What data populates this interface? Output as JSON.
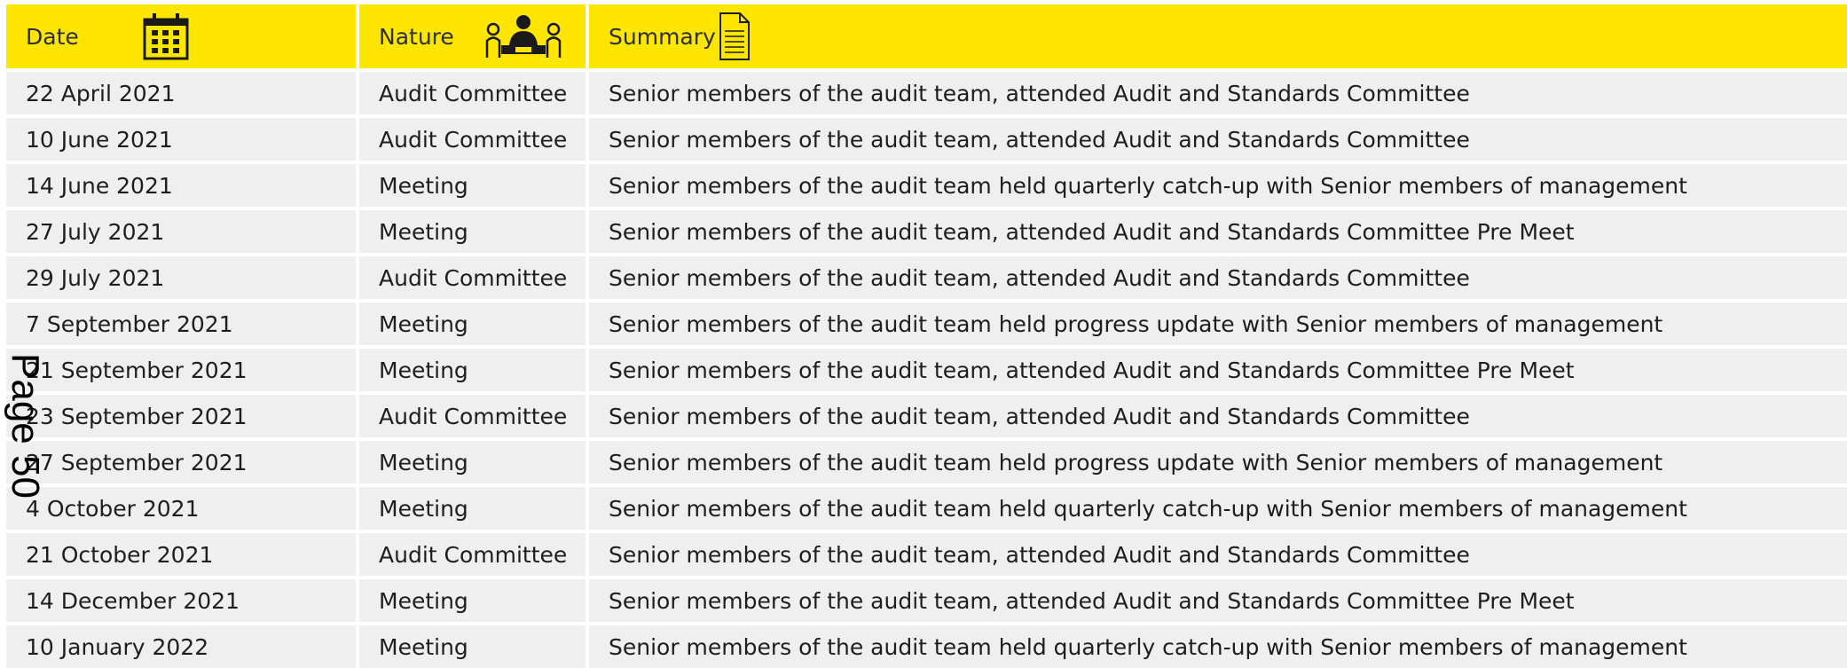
{
  "header": {
    "date_label": "Date",
    "nature_label": "Nature",
    "summary_label": "Summary"
  },
  "icons": {
    "date": "calendar-icon",
    "nature": "meeting-icon",
    "summary": "document-icon"
  },
  "colors": {
    "header_bg": "#ffe600",
    "row_bg": "#efefef"
  },
  "rows": [
    {
      "date": "22 April 2021",
      "nature": "Audit Committee",
      "summary": "Senior members of the audit team, attended Audit and Standards Committee"
    },
    {
      "date": "10 June 2021",
      "nature": "Audit Committee",
      "summary": "Senior members of the audit team, attended Audit and Standards Committee"
    },
    {
      "date": "14 June 2021",
      "nature": "Meeting",
      "summary": "Senior members of the audit team held quarterly catch-up with Senior members of management"
    },
    {
      "date": "27 July 2021",
      "nature": "Meeting",
      "summary": "Senior members of the audit team, attended Audit and Standards Committee Pre Meet"
    },
    {
      "date": "29 July 2021",
      "nature": "Audit Committee",
      "summary": "Senior members of the audit team, attended Audit and Standards Committee"
    },
    {
      "date": "7 September 2021",
      "nature": "Meeting",
      "summary": "Senior members of the audit team held progress update with Senior members of management"
    },
    {
      "date": "21 September 2021",
      "nature": "Meeting",
      "summary": "Senior members of the audit team, attended Audit and Standards Committee Pre Meet"
    },
    {
      "date": "23 September 2021",
      "nature": "Audit Committee",
      "summary": "Senior members of the audit team, attended Audit and Standards Committee"
    },
    {
      "date": "27 September 2021",
      "nature": "Meeting",
      "summary": "Senior members of the audit team held progress update with Senior members of management"
    },
    {
      "date": "4 October 2021",
      "nature": "Meeting",
      "summary": "Senior members of the audit team held quarterly catch-up with Senior members of management"
    },
    {
      "date": "21 October 2021",
      "nature": "Audit Committee",
      "summary": "Senior members of the audit team, attended Audit and Standards Committee"
    },
    {
      "date": "14 December 2021",
      "nature": "Meeting",
      "summary": "Senior members of the audit team, attended Audit and Standards Committee Pre Meet"
    },
    {
      "date": "10 January 2022",
      "nature": "Meeting",
      "summary": "Senior members of the audit team held quarterly catch-up with Senior members of management"
    }
  ],
  "page_marker": "Page 50"
}
